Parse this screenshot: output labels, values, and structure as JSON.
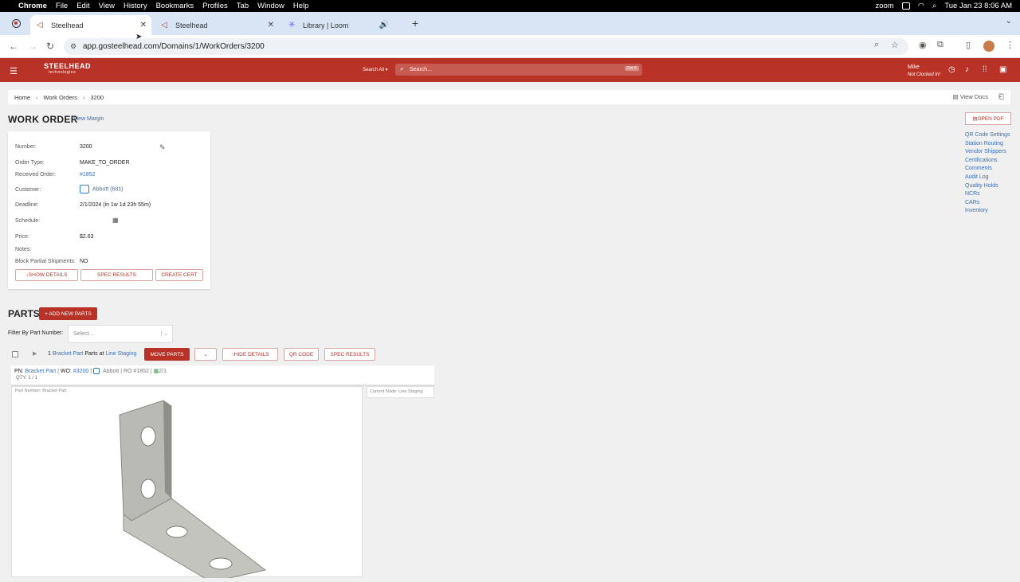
{
  "menubar": {
    "app": "Chrome",
    "items": [
      "File",
      "Edit",
      "View",
      "History",
      "Bookmarks",
      "Profiles",
      "Tab",
      "Window",
      "Help"
    ],
    "zoom": "zoom",
    "datetime": "Tue Jan 23  8:06 AM"
  },
  "tabs": [
    {
      "title": "Steelhead"
    },
    {
      "title": "Steelhead"
    },
    {
      "title": "Library | Loom"
    }
  ],
  "url": "app.gosteelhead.com/Domains/1/WorkOrders/3200",
  "appbar": {
    "brand": "STEELHEAD",
    "brand_sub": "technologies",
    "search_all": "Search All",
    "search_placeholder": "Search...",
    "kbd": "Ctrl K",
    "user_name": "Mike",
    "user_status": "Not Clocked In!"
  },
  "breadcrumb": [
    "Home",
    "Work Orders",
    "3200"
  ],
  "view_docs": "View Docs",
  "title": "WORK ORDER",
  "view_margin": "View Margin",
  "fields": {
    "number_label": "Number:",
    "number": "3200",
    "order_type_label": "Order Type:",
    "order_type": "MAKE_TO_ORDER",
    "received_label": "Received Order:",
    "received": "#1852",
    "customer_label": "Customer:",
    "customer": "Abbott (681)",
    "deadline_label": "Deadline:",
    "deadline": "2/1/2024 (in 1w 1d 23h 55m)",
    "schedule_label": "Schedule:",
    "price_label": "Price:",
    "price": "$2.63",
    "notes_label": "Notes:",
    "block_label": "Block Partial Shipments:",
    "block": "NO"
  },
  "buttons": {
    "show_details": "SHOW DETAILS",
    "spec_results": "SPEC RESULTS",
    "create_cert": "CREATE CERT",
    "open_pdf": "OPEN PDF",
    "add_parts": "+ ADD NEW PARTS",
    "move_parts": "MOVE PARTS",
    "hide_details": "HIDE DETAILS",
    "qr_code": "QR CODE",
    "spec_results2": "SPEC RESULTS"
  },
  "sidelinks": [
    "QR Code Settings",
    "Station Routing",
    "Vendor Shippers",
    "Certifications",
    "Comments",
    "Audit Log",
    "Quality Holds",
    "NCRs",
    "CARs",
    "Inventory"
  ],
  "parts": {
    "title": "PARTS",
    "filter_label": "Filter By Part Number:",
    "filter_placeholder": "Select...",
    "count": "1",
    "part_link": "Bracket Part",
    "parts_at": "Parts at",
    "node": "Line Staging",
    "pn_label": "PN:",
    "pn": "Bracket Part",
    "wo_label": "WO:",
    "wo": "#3200",
    "cust": "Abbott",
    "ro": "RO #1852",
    "date": "2/1",
    "qty": "QTY: 1 / 1",
    "img_label": "Part Number: Bracket Part",
    "current_node": "Current Node: Line Staging"
  }
}
